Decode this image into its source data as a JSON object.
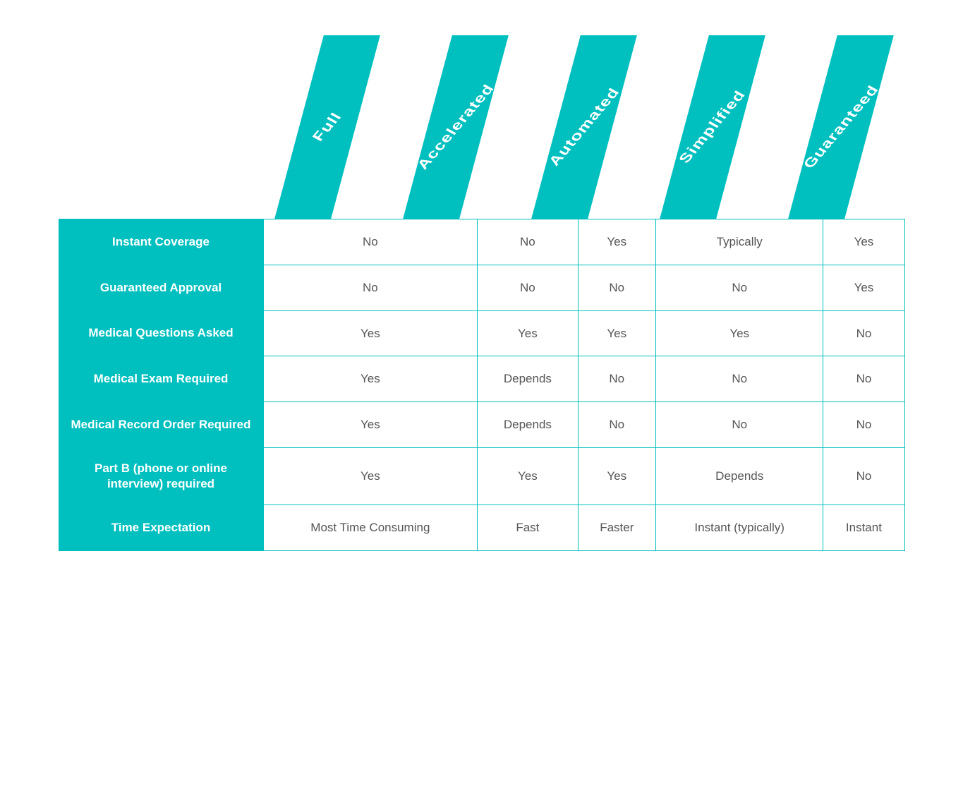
{
  "columns": [
    "Full",
    "Accelerated",
    "Automated",
    "Simplified",
    "Guaranteed"
  ],
  "rows": [
    {
      "header": "Instant Coverage",
      "cells": [
        "No",
        "No",
        "Yes",
        "Typically",
        "Yes"
      ]
    },
    {
      "header": "Guaranteed Approval",
      "cells": [
        "No",
        "No",
        "No",
        "No",
        "Yes"
      ]
    },
    {
      "header": "Medical Questions Asked",
      "cells": [
        "Yes",
        "Yes",
        "Yes",
        "Yes",
        "No"
      ]
    },
    {
      "header": "Medical Exam Required",
      "cells": [
        "Yes",
        "Depends",
        "No",
        "No",
        "No"
      ]
    },
    {
      "header": "Medical Record Order Required",
      "cells": [
        "Yes",
        "Depends",
        "No",
        "No",
        "No"
      ]
    },
    {
      "header": "Part B (phone or online interview) required",
      "cells": [
        "Yes",
        "Yes",
        "Yes",
        "Depends",
        "No"
      ]
    },
    {
      "header": "Time Expectation",
      "cells": [
        "Most Time Consuming",
        "Fast",
        "Faster",
        "Instant (typically)",
        "Instant"
      ]
    }
  ]
}
